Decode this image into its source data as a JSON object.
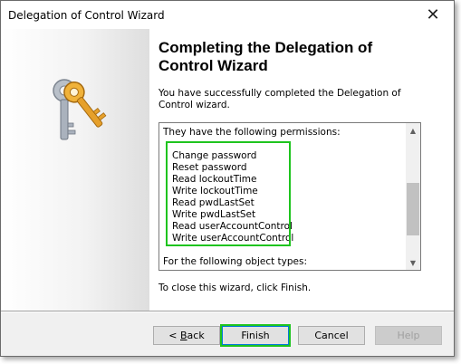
{
  "window": {
    "title": "Delegation of Control Wizard",
    "close_glyph": "✕"
  },
  "heading": "Completing the Delegation of Control Wizard",
  "intro": "You have successfully completed the Delegation of Control wizard.",
  "summary": {
    "permissions_header": "They have the following permissions:",
    "permissions": [
      "Change password",
      "Reset password",
      "Read lockoutTime",
      "Write lockoutTime",
      "Read pwdLastSet",
      "Write pwdLastSet",
      "Read userAccountControl",
      "Write userAccountControl"
    ],
    "object_types_header": "For the following object types:"
  },
  "footer_note": "To close this wizard, click Finish.",
  "buttons": {
    "back_prefix": "< ",
    "back_mnemonic": "B",
    "back_rest": "ack",
    "finish": "Finish",
    "cancel": "Cancel",
    "help": "Help"
  },
  "icons": {
    "wizard_art": "keys-icon",
    "scroll_up": "chevron-up-icon",
    "scroll_down": "chevron-down-icon",
    "close": "close-icon"
  },
  "colors": {
    "highlight": "#1ec41e",
    "focus": "#0078d7",
    "key_gold": "#e8a82a",
    "key_silver": "#a8b0bc"
  }
}
